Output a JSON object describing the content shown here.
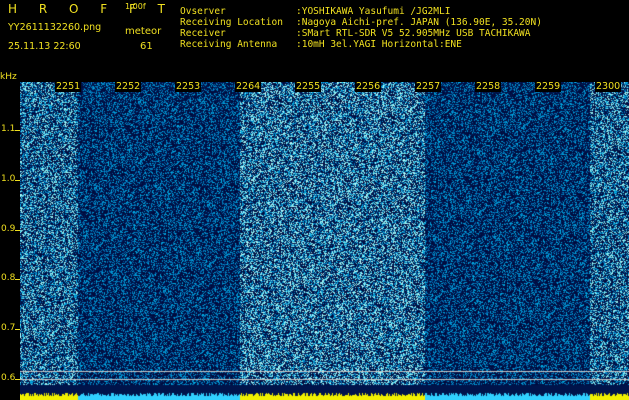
{
  "header": {
    "brand": "H R O F F T",
    "version": "1.00f",
    "filename": "YY2611132260.png",
    "meteor_label": "meteor",
    "datetime": "25.11.13 22:60",
    "meteor_count": "61"
  },
  "info": [
    {
      "key": "Ovserver",
      "value": ":YOSHIKAWA Yasufumi /JG2MLI"
    },
    {
      "key": "Receiving Location",
      "value": ":Nagoya Aichi-pref. JAPAN (136.90E, 35.20N)"
    },
    {
      "key": "Receiver",
      "value": ":SMart RTL-SDR V5 52.905MHz USB TACHIKAWA"
    },
    {
      "key": "Receiving Antenna",
      "value": ":10mH 3el.YAGI Horizontal:ENE"
    }
  ],
  "axis": {
    "unit": "kHz",
    "freq_labels": [
      "1.1",
      "1.0",
      "0.9",
      "0.8",
      "0.7",
      "0.6"
    ],
    "minute_labels": [
      "2251",
      "2252",
      "2253",
      "2264",
      "2255",
      "2256",
      "2257",
      "2258",
      "2259",
      "2300"
    ]
  },
  "colors": {
    "text": "#f0e020",
    "noise_low": "#001a6a",
    "noise_high": "#40c0e8",
    "reference_line": "#ffffff"
  }
}
